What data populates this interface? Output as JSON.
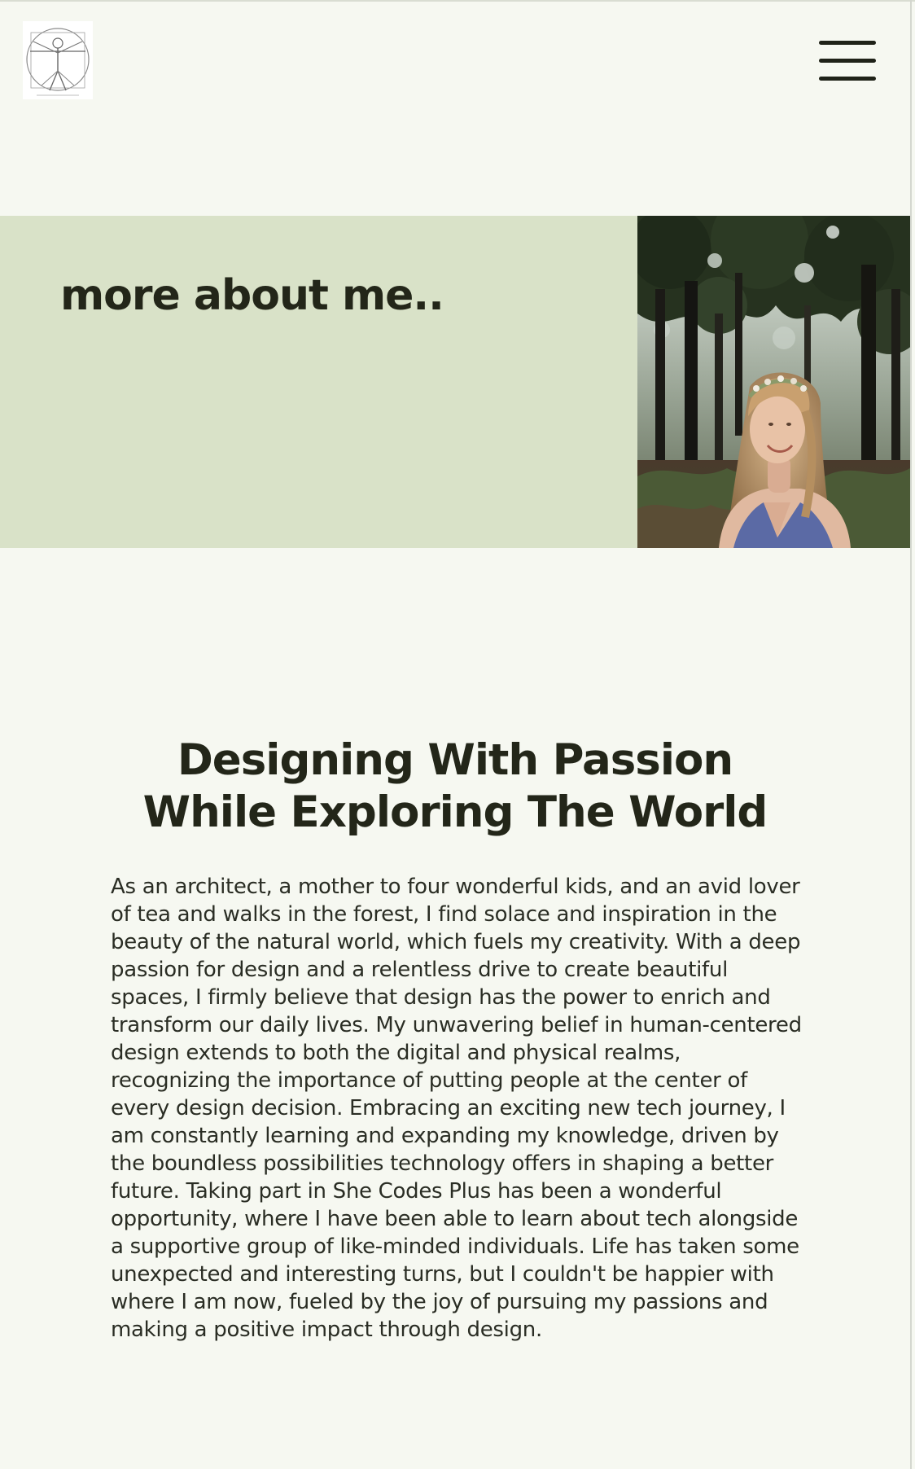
{
  "header": {
    "logo_alt": "Vitruvian Man logo",
    "menu_icon": "hamburger-menu-icon"
  },
  "hero": {
    "title": "more about me..",
    "photo_alt": "Smiling woman wearing a flower crown in a forest",
    "panel_color": "#d9e2c8"
  },
  "about": {
    "heading_line1": "Designing With Passion",
    "heading_line2": "While Exploring The World",
    "paragraph": "As an architect, a mother to four wonderful kids, and an avid lover of tea and walks in the forest, I find solace and inspiration in the beauty of the natural world, which fuels my creativity. With a deep passion for design and a relentless drive to create beautiful spaces, I firmly believe that design has the power to enrich and transform our daily lives. My unwavering belief in human-centered design extends to both the digital and physical realms, recognizing the importance of putting people at the center of every design decision. Embracing an exciting new tech journey, I am constantly learning and expanding my knowledge, driven by the boundless possibilities technology offers in shaping a better future. Taking part in She Codes Plus has been a wonderful opportunity, where I have been able to learn about tech alongside a supportive group of like-minded individuals. Life has taken some unexpected and interesting turns, but I couldn't be happier with where I am now, fueled by the joy of pursuing my passions and making a positive impact through design."
  },
  "colors": {
    "background": "#f6f8f1",
    "text": "#232619",
    "accent_panel": "#d9e2c8"
  }
}
